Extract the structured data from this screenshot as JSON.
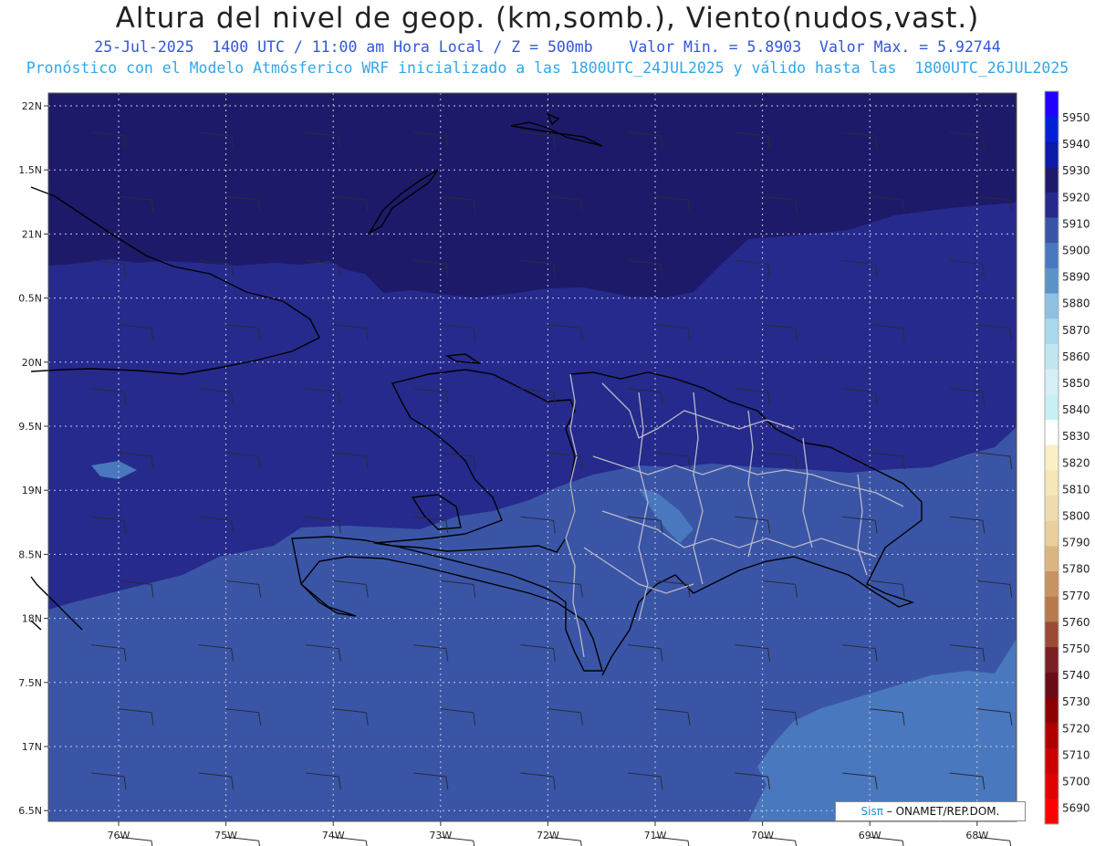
{
  "header": {
    "title": "Altura del nivel de geop. (km,somb.), Viento(nudos,vast.)",
    "line1": "25-Jul-2025  1400 UTC / 11:00 am Hora Local / Z = 500mb    Valor Min. = 5.8903  Valor Max. = 5.92744",
    "line2": "Pronóstico con el Modelo Atmósferico WRF inicializado a las 1800UTC_24JUL2025 y válido hasta las  1800UTC_26JUL2025"
  },
  "map": {
    "lat_labels": [
      "22N",
      "1.5N",
      "21N",
      "0.5N",
      "20N",
      "9.5N",
      "19N",
      "8.5N",
      "18N",
      "7.5N",
      "17N",
      "6.5N"
    ],
    "lon_labels": [
      "76W",
      "75W",
      "74W",
      "73W",
      "72W",
      "71W",
      "70W",
      "69W",
      "68W"
    ],
    "fill_colors": {
      "dark": "#1d1a6a",
      "mid": "#262a8c",
      "light": "#3a55a6",
      "lighter": "#4a78be",
      "lightest": "#5c8ec8"
    }
  },
  "colorbar": {
    "levels": [
      "5950",
      "5940",
      "5930",
      "5920",
      "5910",
      "5900",
      "5890",
      "5880",
      "5870",
      "5860",
      "5850",
      "5840",
      "5830",
      "5820",
      "5810",
      "5800",
      "5790",
      "5780",
      "5770",
      "5760",
      "5750",
      "5740",
      "5730",
      "5720",
      "5710",
      "5700",
      "5690"
    ],
    "colors": [
      "#1f00ff",
      "#0020d8",
      "#0c1aa8",
      "#1d1a6a",
      "#262a8c",
      "#3a55a6",
      "#4a78be",
      "#5b92c8",
      "#8ec0e2",
      "#a9d9ec",
      "#c0e6f2",
      "#d6eff6",
      "#c8f0f4",
      "#ffffff",
      "#fbefc6",
      "#f6e6b8",
      "#efdcae",
      "#e8cf9d",
      "#dbb57f",
      "#c8935e",
      "#b87a4b",
      "#9b4a36",
      "#7a1f23",
      "#6a0c16",
      "#8b0000",
      "#b00000",
      "#cc0000",
      "#e00000",
      "#ff0000"
    ]
  },
  "credit": {
    "sis": "Sisπ",
    "rest": " – ONAMET/REP.DOM."
  }
}
